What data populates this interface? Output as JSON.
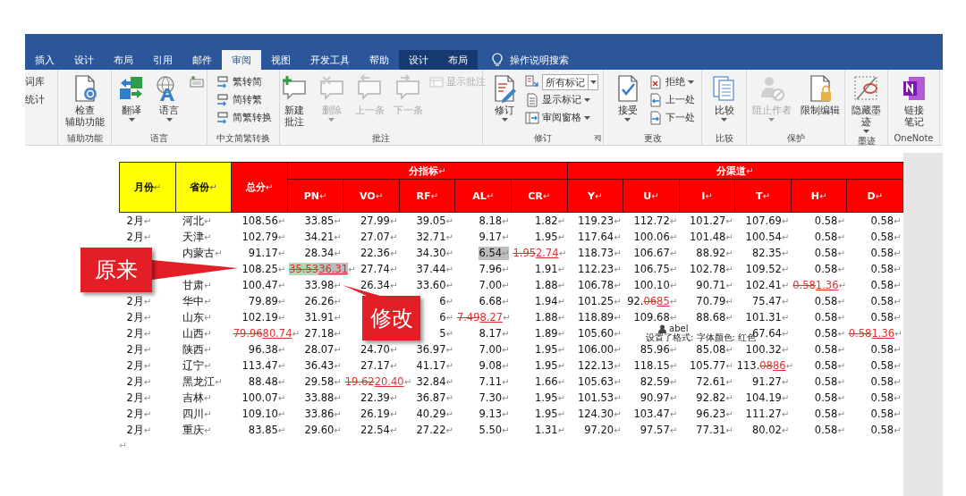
{
  "ribbon": {
    "tabs": [
      {
        "label": "插入",
        "selected": false,
        "contextual": false
      },
      {
        "label": "设计",
        "selected": false,
        "contextual": false
      },
      {
        "label": "布局",
        "selected": false,
        "contextual": false
      },
      {
        "label": "引用",
        "selected": false,
        "contextual": false
      },
      {
        "label": "邮件",
        "selected": false,
        "contextual": false
      },
      {
        "label": "审阅",
        "selected": true,
        "contextual": false
      },
      {
        "label": "视图",
        "selected": false,
        "contextual": false
      },
      {
        "label": "开发工具",
        "selected": false,
        "contextual": false
      },
      {
        "label": "帮助",
        "selected": false,
        "contextual": false
      },
      {
        "label": "设计",
        "selected": false,
        "contextual": true
      },
      {
        "label": "布局",
        "selected": false,
        "contextual": true
      }
    ],
    "tell_me": "操作说明搜索",
    "groups": [
      {
        "items": [
          {
            "kind": "small",
            "lines": [
              "词库"
            ],
            "disabled": false,
            "dropdown": false
          },
          {
            "kind": "small",
            "lines": [
              "统计"
            ],
            "disabled": false,
            "dropdown": false
          }
        ]
      },
      {
        "label": "辅助功能",
        "items": [
          {
            "kind": "large",
            "lines": [
              "检查",
              "辅助功能"
            ],
            "disabled": false,
            "dropdown": false
          }
        ]
      },
      {
        "label": "语言",
        "items": [
          {
            "kind": "large",
            "lines": [
              "翻译"
            ],
            "disabled": false,
            "dropdown": true
          },
          {
            "kind": "large",
            "lines": [
              "语言"
            ],
            "disabled": false,
            "dropdown": true
          },
          {
            "kind": "icon",
            "disabled": false,
            "dropdown": false
          }
        ]
      },
      {
        "label": "中文简繁转换",
        "items": [
          {
            "kind": "small",
            "lines": [
              "繁转简"
            ],
            "disabled": false,
            "dropdown": false
          },
          {
            "kind": "small",
            "lines": [
              "简转繁"
            ],
            "disabled": false,
            "dropdown": false
          },
          {
            "kind": "small",
            "lines": [
              "简繁转换"
            ],
            "disabled": false,
            "dropdown": false
          }
        ]
      },
      {
        "label": "批注",
        "items": [
          {
            "kind": "large",
            "lines": [
              "新建",
              "批注"
            ],
            "disabled": false,
            "dropdown": false
          },
          {
            "kind": "large",
            "lines": [
              "删除"
            ],
            "disabled": true,
            "dropdown": true
          },
          {
            "kind": "large",
            "lines": [
              "上一条"
            ],
            "disabled": true,
            "dropdown": false
          },
          {
            "kind": "large",
            "lines": [
              "下一条"
            ],
            "disabled": true,
            "dropdown": false
          },
          {
            "kind": "small",
            "lines": [
              "显示批注"
            ],
            "disabled": true,
            "dropdown": false
          }
        ]
      },
      {
        "label": "修订",
        "launcher": true,
        "items": [
          {
            "kind": "large",
            "lines": [
              "修订"
            ],
            "disabled": false,
            "dropdown": true
          },
          {
            "kind": "combo",
            "value": "所有标记",
            "disabled": false,
            "dropdown": true
          },
          {
            "kind": "small",
            "lines": [
              "显示标记"
            ],
            "disabled": false,
            "dropdown": true
          },
          {
            "kind": "small",
            "lines": [
              "审阅窗格"
            ],
            "disabled": false,
            "dropdown": true
          }
        ]
      },
      {
        "label": "更改",
        "items": [
          {
            "kind": "large",
            "lines": [
              "接受"
            ],
            "disabled": false,
            "dropdown": true
          },
          {
            "kind": "small",
            "lines": [
              "拒绝"
            ],
            "disabled": false,
            "dropdown": true
          },
          {
            "kind": "small",
            "lines": [
              "上一处"
            ],
            "disabled": false,
            "dropdown": false
          },
          {
            "kind": "small",
            "lines": [
              "下一处"
            ],
            "disabled": false,
            "dropdown": false
          }
        ]
      },
      {
        "label": "比较",
        "items": [
          {
            "kind": "large",
            "lines": [
              "比较"
            ],
            "disabled": false,
            "dropdown": true
          }
        ]
      },
      {
        "label": "保护",
        "items": [
          {
            "kind": "large",
            "lines": [
              "阻止作者"
            ],
            "disabled": true,
            "dropdown": true
          },
          {
            "kind": "large",
            "lines": [
              "限制编辑"
            ],
            "disabled": false,
            "dropdown": false
          }
        ]
      },
      {
        "label": "墨迹",
        "items": [
          {
            "kind": "large",
            "lines": [
              "隐藏墨",
              "迹"
            ],
            "disabled": false,
            "dropdown": true
          }
        ]
      },
      {
        "label": "OneNote",
        "items": [
          {
            "kind": "large",
            "lines": [
              "链接",
              "笔记"
            ],
            "disabled": false,
            "dropdown": false
          }
        ]
      }
    ]
  },
  "table": {
    "paragraph_mark": "↵",
    "header": [
      {
        "label": "月份",
        "color": "#ffff00"
      },
      {
        "label": "省份",
        "color": "#ffff00"
      },
      {
        "label": "总分",
        "color": "#ff0000"
      },
      {
        "label": "分指标",
        "color": "#ff0000",
        "columns": [
          {
            "label": "PN"
          },
          {
            "label": "VO"
          },
          {
            "label": "RF"
          },
          {
            "label": "AL"
          },
          {
            "label": "CR"
          }
        ]
      },
      {
        "label": "分渠道",
        "color": "#ff0000",
        "columns": [
          {
            "label": "Y"
          },
          {
            "label": "U"
          },
          {
            "label": "I"
          },
          {
            "label": "T"
          },
          {
            "label": "H"
          },
          {
            "label": "D"
          }
        ]
      }
    ],
    "rows": [
      [
        "2月",
        "河北",
        "108.56",
        "33.85",
        "27.99",
        "39.05",
        "8.18",
        "1.82",
        "119.23",
        "112.72",
        "101.27",
        "107.69",
        "0.58",
        "0.58"
      ],
      [
        "2月",
        "天津",
        "102.79",
        "34.21",
        "27.07",
        "32.71",
        "9.17",
        "1.95",
        "117.64",
        "100.06",
        "101.48",
        "100.54",
        "0.58",
        "0.58"
      ],
      [
        null,
        "内蒙古",
        "91.17",
        "28.34",
        "22.36",
        "34.30",
        {
          "kind": "highlight",
          "text": "6.54"
        },
        {
          "kind": "revision",
          "deleted": "1.95",
          "inserted": "2.74"
        },
        "118.73",
        "106.67",
        "88.92",
        "82.35",
        "0.58",
        "0.58"
      ],
      [
        null,
        null,
        "108.25",
        {
          "kind": "revision",
          "deleted": "35.53",
          "inserted": "36.31",
          "highlight": true
        },
        "27.74",
        "37.44",
        "7.96",
        "1.91",
        "112.23",
        "106.75",
        "102.78",
        "109.52",
        "0.58",
        "0.58"
      ],
      [
        null,
        "甘肃",
        "100.47",
        "33.98",
        "26.34",
        "33.60",
        "7.00",
        "1.88",
        "106.78",
        "100.10",
        "90.71",
        "102.41",
        {
          "kind": "revision",
          "deleted": "0.58",
          "inserted": "1.36"
        },
        "0.58"
      ],
      [
        "2月",
        "华中",
        "79.89",
        "26.26",
        null,
        "6",
        "6.68",
        "1.94",
        "101.25",
        {
          "kind": "revision",
          "kept": "92.",
          "deleted": "06",
          "inserted": "85"
        },
        "70.79",
        "75.47",
        "0.58",
        "0.58"
      ],
      [
        "2月",
        "山东",
        "102.19",
        "31.91",
        null,
        "6",
        {
          "kind": "revision",
          "deleted": "7.49",
          "inserted": "8.27"
        },
        "1.88",
        "118.89",
        "109.68",
        "88.68",
        "101.31",
        "0.58",
        "0.58"
      ],
      [
        "2月",
        "山西",
        {
          "kind": "revision",
          "deleted": "79.96",
          "inserted": "80.74"
        },
        "27.18",
        null,
        "5",
        "8.17",
        "1.89",
        "105.60",
        null,
        null,
        "67.64",
        "0.58",
        {
          "kind": "revision",
          "deleted": "0.58",
          "inserted": "1.36"
        }
      ],
      [
        "2月",
        "陕西",
        "96.38",
        "28.07",
        "24.70",
        "36.97",
        "7.00",
        "1.95",
        "106.00",
        "85.96",
        "85.08",
        "100.32",
        "0.58",
        "0.58"
      ],
      [
        "2月",
        "辽宁",
        "113.47",
        "36.43",
        "27.17",
        "41.17",
        "9.08",
        "1.95",
        "122.13",
        "118.15",
        "105.77",
        {
          "kind": "revision",
          "kept": "113.",
          "deleted": "08",
          "inserted": "86"
        },
        "0.58",
        "0.58"
      ],
      [
        "2月",
        "黑龙江",
        "88.48",
        "29.58",
        {
          "kind": "revision",
          "deleted": "19.62",
          "inserted": "20.40"
        },
        "32.84",
        "7.11",
        "1.66",
        "105.63",
        "82.59",
        "72.61",
        "91.27",
        "0.58",
        "0.58"
      ],
      [
        "2月",
        "吉林",
        "100.07",
        "33.88",
        "22.39",
        "36.87",
        "7.30",
        "1.95",
        "101.53",
        "90.97",
        "92.82",
        "104.19",
        "0.58",
        "0.58"
      ],
      [
        "2月",
        "四川",
        "109.10",
        "33.86",
        "26.19",
        "40.29",
        "9.13",
        "1.95",
        "124.30",
        "103.47",
        "96.23",
        "111.27",
        "0.58",
        "0.58"
      ],
      [
        "2月",
        "重庆",
        "83.85",
        "29.60",
        "22.54",
        "27.22",
        "5.50",
        "1.31",
        "97.20",
        "97.57",
        "77.31",
        "80.02",
        "0.58",
        "0.58"
      ]
    ]
  },
  "end_mark": "↵",
  "callouts": [
    {
      "text": "原来"
    },
    {
      "text": "修改"
    }
  ],
  "tooltip": {
    "author": "abel",
    "text": "设置了格式: 字体颜色: 红色"
  }
}
